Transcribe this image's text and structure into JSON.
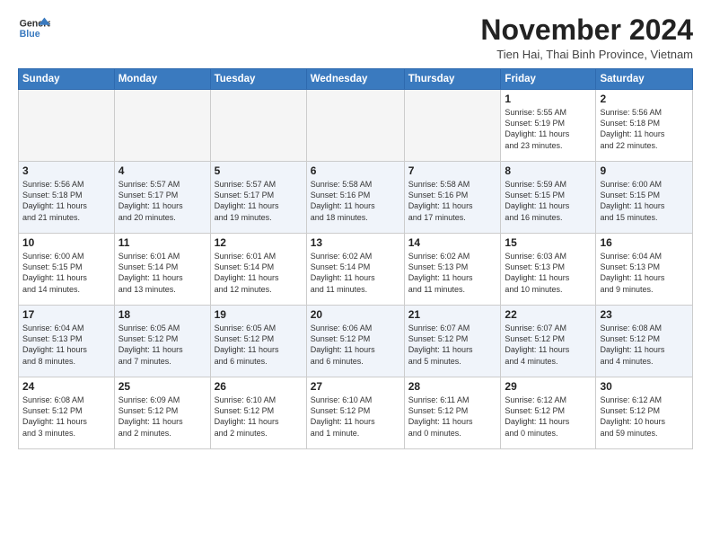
{
  "logo": {
    "line1": "General",
    "line2": "Blue"
  },
  "title": "November 2024",
  "location": "Tien Hai, Thai Binh Province, Vietnam",
  "header": {
    "days": [
      "Sunday",
      "Monday",
      "Tuesday",
      "Wednesday",
      "Thursday",
      "Friday",
      "Saturday"
    ]
  },
  "weeks": [
    {
      "cells": [
        {
          "day": "",
          "info": ""
        },
        {
          "day": "",
          "info": ""
        },
        {
          "day": "",
          "info": ""
        },
        {
          "day": "",
          "info": ""
        },
        {
          "day": "",
          "info": ""
        },
        {
          "day": "1",
          "info": "Sunrise: 5:55 AM\nSunset: 5:19 PM\nDaylight: 11 hours\nand 23 minutes."
        },
        {
          "day": "2",
          "info": "Sunrise: 5:56 AM\nSunset: 5:18 PM\nDaylight: 11 hours\nand 22 minutes."
        }
      ]
    },
    {
      "cells": [
        {
          "day": "3",
          "info": "Sunrise: 5:56 AM\nSunset: 5:18 PM\nDaylight: 11 hours\nand 21 minutes."
        },
        {
          "day": "4",
          "info": "Sunrise: 5:57 AM\nSunset: 5:17 PM\nDaylight: 11 hours\nand 20 minutes."
        },
        {
          "day": "5",
          "info": "Sunrise: 5:57 AM\nSunset: 5:17 PM\nDaylight: 11 hours\nand 19 minutes."
        },
        {
          "day": "6",
          "info": "Sunrise: 5:58 AM\nSunset: 5:16 PM\nDaylight: 11 hours\nand 18 minutes."
        },
        {
          "day": "7",
          "info": "Sunrise: 5:58 AM\nSunset: 5:16 PM\nDaylight: 11 hours\nand 17 minutes."
        },
        {
          "day": "8",
          "info": "Sunrise: 5:59 AM\nSunset: 5:15 PM\nDaylight: 11 hours\nand 16 minutes."
        },
        {
          "day": "9",
          "info": "Sunrise: 6:00 AM\nSunset: 5:15 PM\nDaylight: 11 hours\nand 15 minutes."
        }
      ]
    },
    {
      "cells": [
        {
          "day": "10",
          "info": "Sunrise: 6:00 AM\nSunset: 5:15 PM\nDaylight: 11 hours\nand 14 minutes."
        },
        {
          "day": "11",
          "info": "Sunrise: 6:01 AM\nSunset: 5:14 PM\nDaylight: 11 hours\nand 13 minutes."
        },
        {
          "day": "12",
          "info": "Sunrise: 6:01 AM\nSunset: 5:14 PM\nDaylight: 11 hours\nand 12 minutes."
        },
        {
          "day": "13",
          "info": "Sunrise: 6:02 AM\nSunset: 5:14 PM\nDaylight: 11 hours\nand 11 minutes."
        },
        {
          "day": "14",
          "info": "Sunrise: 6:02 AM\nSunset: 5:13 PM\nDaylight: 11 hours\nand 11 minutes."
        },
        {
          "day": "15",
          "info": "Sunrise: 6:03 AM\nSunset: 5:13 PM\nDaylight: 11 hours\nand 10 minutes."
        },
        {
          "day": "16",
          "info": "Sunrise: 6:04 AM\nSunset: 5:13 PM\nDaylight: 11 hours\nand 9 minutes."
        }
      ]
    },
    {
      "cells": [
        {
          "day": "17",
          "info": "Sunrise: 6:04 AM\nSunset: 5:13 PM\nDaylight: 11 hours\nand 8 minutes."
        },
        {
          "day": "18",
          "info": "Sunrise: 6:05 AM\nSunset: 5:12 PM\nDaylight: 11 hours\nand 7 minutes."
        },
        {
          "day": "19",
          "info": "Sunrise: 6:05 AM\nSunset: 5:12 PM\nDaylight: 11 hours\nand 6 minutes."
        },
        {
          "day": "20",
          "info": "Sunrise: 6:06 AM\nSunset: 5:12 PM\nDaylight: 11 hours\nand 6 minutes."
        },
        {
          "day": "21",
          "info": "Sunrise: 6:07 AM\nSunset: 5:12 PM\nDaylight: 11 hours\nand 5 minutes."
        },
        {
          "day": "22",
          "info": "Sunrise: 6:07 AM\nSunset: 5:12 PM\nDaylight: 11 hours\nand 4 minutes."
        },
        {
          "day": "23",
          "info": "Sunrise: 6:08 AM\nSunset: 5:12 PM\nDaylight: 11 hours\nand 4 minutes."
        }
      ]
    },
    {
      "cells": [
        {
          "day": "24",
          "info": "Sunrise: 6:08 AM\nSunset: 5:12 PM\nDaylight: 11 hours\nand 3 minutes."
        },
        {
          "day": "25",
          "info": "Sunrise: 6:09 AM\nSunset: 5:12 PM\nDaylight: 11 hours\nand 2 minutes."
        },
        {
          "day": "26",
          "info": "Sunrise: 6:10 AM\nSunset: 5:12 PM\nDaylight: 11 hours\nand 2 minutes."
        },
        {
          "day": "27",
          "info": "Sunrise: 6:10 AM\nSunset: 5:12 PM\nDaylight: 11 hours\nand 1 minute."
        },
        {
          "day": "28",
          "info": "Sunrise: 6:11 AM\nSunset: 5:12 PM\nDaylight: 11 hours\nand 0 minutes."
        },
        {
          "day": "29",
          "info": "Sunrise: 6:12 AM\nSunset: 5:12 PM\nDaylight: 11 hours\nand 0 minutes."
        },
        {
          "day": "30",
          "info": "Sunrise: 6:12 AM\nSunset: 5:12 PM\nDaylight: 10 hours\nand 59 minutes."
        }
      ]
    }
  ]
}
